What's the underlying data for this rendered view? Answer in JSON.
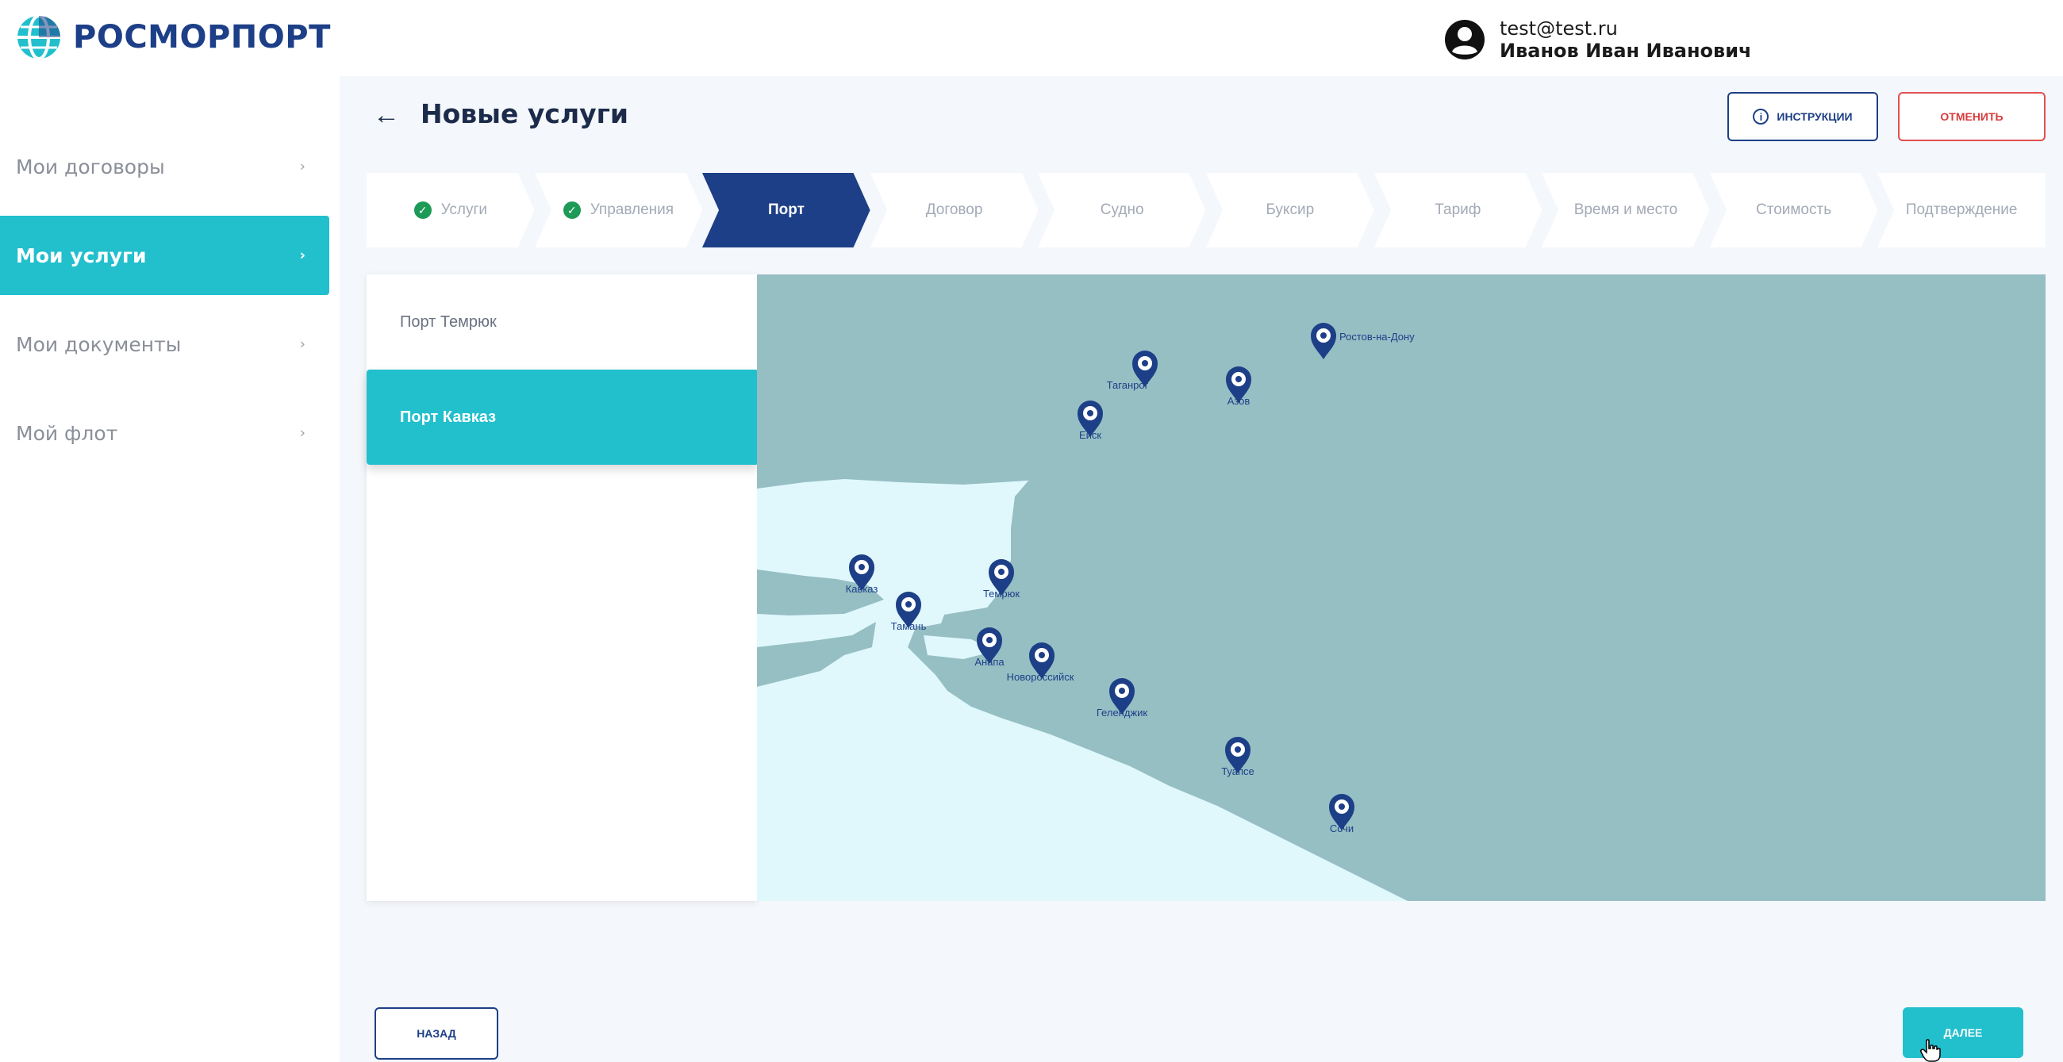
{
  "brand": {
    "name": "РОСМОРПОРТ",
    "color": "#1d3f87",
    "accent": "#22bfcd"
  },
  "user": {
    "email": "test@test.ru",
    "name": "Иванов Иван Иванович"
  },
  "sidebar": {
    "items": [
      {
        "label": "Мои договоры",
        "active": false
      },
      {
        "label": "Мои услуги",
        "active": true
      },
      {
        "label": "Мои документы",
        "active": false
      },
      {
        "label": "Мой флот",
        "active": false
      }
    ]
  },
  "header": {
    "title": "Новые услуги",
    "instructions_label": "ИНСТРУКЦИИ",
    "cancel_label": "ОТМЕНИТЬ"
  },
  "steps": [
    {
      "label": "Услуги",
      "state": "done"
    },
    {
      "label": "Управления",
      "state": "done"
    },
    {
      "label": "Порт",
      "state": "active"
    },
    {
      "label": "Договор",
      "state": "todo"
    },
    {
      "label": "Судно",
      "state": "todo"
    },
    {
      "label": "Буксир",
      "state": "todo"
    },
    {
      "label": "Тариф",
      "state": "todo"
    },
    {
      "label": "Время и место",
      "state": "todo"
    },
    {
      "label": "Стоимость",
      "state": "todo"
    },
    {
      "label": "Подтверждение",
      "state": "todo"
    }
  ],
  "ports": [
    {
      "label": "Порт Темрюк",
      "active": false
    },
    {
      "label": "Порт Кавказ",
      "active": true
    }
  ],
  "map": {
    "sea_color": "#e0f8fc",
    "land_color": "#96bfc4",
    "pin_color": "#1d3f87",
    "markers": [
      {
        "label": "Таганрог"
      },
      {
        "label": "Азов"
      },
      {
        "label": "Ростов-на-Дону"
      },
      {
        "label": "Ейск"
      },
      {
        "label": "Кавказ"
      },
      {
        "label": "Темрюк"
      },
      {
        "label": "Тамань"
      },
      {
        "label": "Анапа"
      },
      {
        "label": "Новороссийск"
      },
      {
        "label": "Геленджик"
      },
      {
        "label": "Туапсе"
      },
      {
        "label": "Сочи"
      }
    ]
  },
  "footer": {
    "back_label": "НАЗАД",
    "next_label": "ДАЛЕЕ"
  }
}
